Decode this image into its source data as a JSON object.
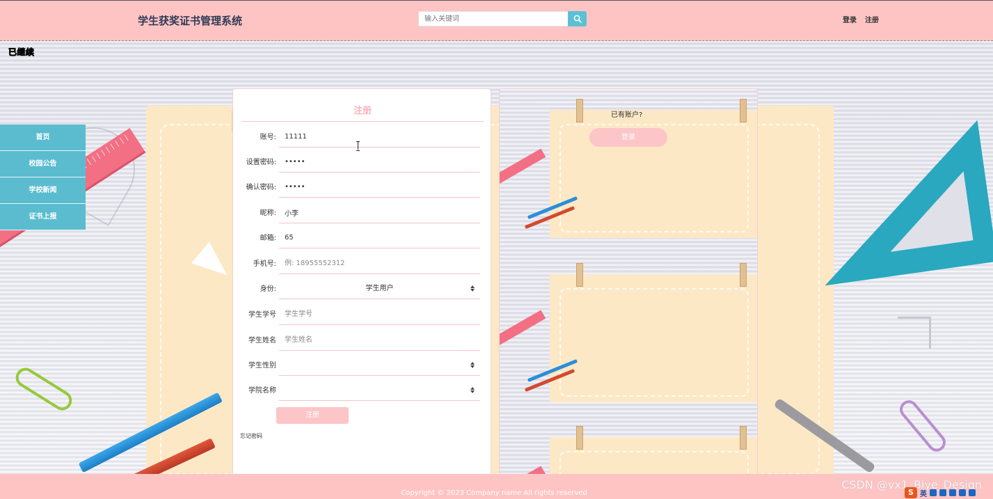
{
  "header": {
    "site_title": "学生获奖证书管理系统",
    "search_placeholder": "输入关键词",
    "login_link": "登录",
    "register_link": "注册"
  },
  "status_overlay": "已继续",
  "side_menu": {
    "items": [
      {
        "label": "首页"
      },
      {
        "label": "校园公告"
      },
      {
        "label": "学校新闻"
      },
      {
        "label": "证书上报"
      }
    ]
  },
  "register_form": {
    "title": "注册",
    "fields": [
      {
        "label": "账号:",
        "value": "11111",
        "placeholder": ""
      },
      {
        "label": "设置密码:",
        "value": "•••••",
        "placeholder": ""
      },
      {
        "label": "确认密码:",
        "value": "•••••",
        "placeholder": ""
      },
      {
        "label": "昵称:",
        "value": "小李",
        "placeholder": ""
      },
      {
        "label": "邮箱:",
        "value": "65",
        "placeholder": ""
      },
      {
        "label": "手机号:",
        "value": "",
        "placeholder": "例: 18955552312"
      }
    ],
    "identity": {
      "label": "身份:",
      "selected": "学生用户"
    },
    "student_no": {
      "label": "学生学号",
      "placeholder": "学生学号"
    },
    "student_name": {
      "label": "学生姓名",
      "placeholder": "学生姓名"
    },
    "student_gender": {
      "label": "学生性别",
      "selected": ""
    },
    "college_name": {
      "label": "学院名称",
      "selected": ""
    },
    "submit_label": "注册",
    "forgot_label": "忘记密码"
  },
  "login_panel": {
    "prompt": "已有账户?",
    "login_label": "登录"
  },
  "footer": {
    "copyright": "Copyright © 2023 Company name All rights reserved"
  },
  "watermark": "CSDN @vx1_Biye_Design",
  "tray": {
    "ime_label": "英"
  },
  "colors": {
    "header_bg": "#fec4c4",
    "accent_teal": "#5bc0d5",
    "button_pink": "#fcc5c7"
  }
}
